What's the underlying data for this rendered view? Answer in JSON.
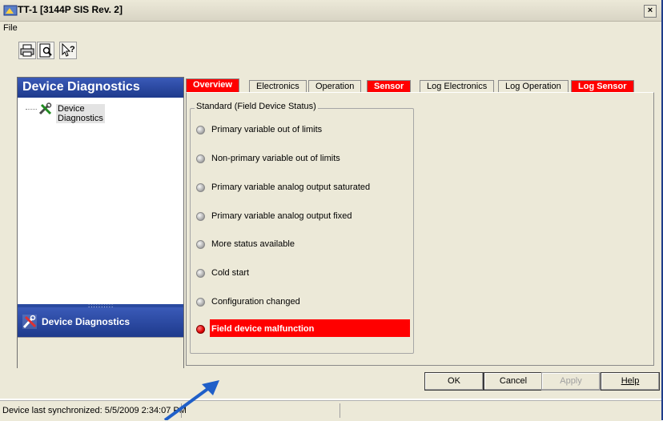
{
  "window": {
    "title": "TT-1 [3144P SIS Rev. 2]",
    "close_glyph": "×"
  },
  "menu": {
    "file": "File"
  },
  "toolbar": {
    "buttons": [
      {
        "icon": "print-icon"
      },
      {
        "icon": "print-preview-icon"
      },
      {
        "icon": "context-help-icon"
      }
    ]
  },
  "left_pane": {
    "header": "Device Diagnostics",
    "tree_item": "Device Diagnostics",
    "footer": "Device Diagnostics",
    "splitter_grip": "::::::::::"
  },
  "tabs": [
    {
      "label": "Overview",
      "alert": true,
      "active": true
    },
    {
      "label": "Electronics",
      "alert": false
    },
    {
      "label": "Operation",
      "alert": false
    },
    {
      "label": "Sensor",
      "alert": true
    },
    {
      "label": "Log Electronics",
      "alert": false
    },
    {
      "label": "Log Operation",
      "alert": false
    },
    {
      "label": "Log Sensor",
      "alert": true
    }
  ],
  "group": {
    "legend": "Standard (Field Device Status)",
    "items": [
      {
        "label": "Primary variable out of limits",
        "active": false
      },
      {
        "label": "Non-primary variable out of limits",
        "active": false
      },
      {
        "label": "Primary variable analog output saturated",
        "active": false
      },
      {
        "label": "Primary variable analog output fixed",
        "active": false
      },
      {
        "label": "More status available",
        "active": false
      },
      {
        "label": "Cold start",
        "active": false
      },
      {
        "label": "Configuration changed",
        "active": false
      },
      {
        "label": "Field device malfunction",
        "active": true
      }
    ]
  },
  "buttons": {
    "ok": "OK",
    "cancel": "Cancel",
    "apply": "Apply",
    "help": "Help"
  },
  "status_bar": {
    "text": "Device last synchronized: 5/5/2009 2:34:07 PM"
  },
  "colors": {
    "alert": "#ff0000",
    "pane_header": "#2a4aa0",
    "annotation_arrow": "#1f5fc8"
  }
}
